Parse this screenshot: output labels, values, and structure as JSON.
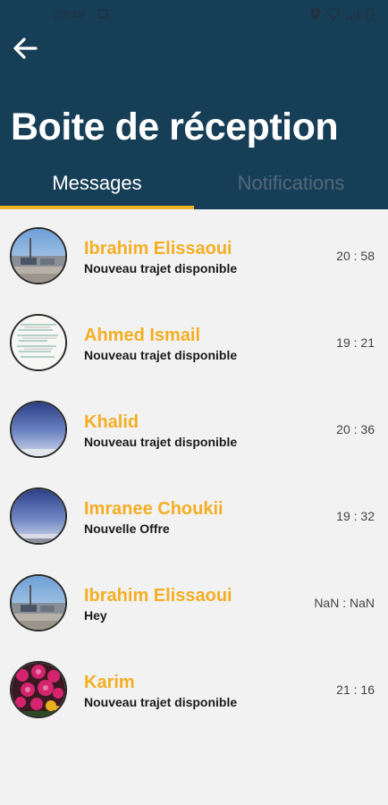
{
  "status": {
    "time": "20:48"
  },
  "header": {
    "title": "Boite de réception",
    "back_icon": "arrow-left-icon"
  },
  "tabs": [
    {
      "label": "Messages",
      "active": true
    },
    {
      "label": "Notifications",
      "active": false
    }
  ],
  "colors": {
    "header_bg": "#163e57",
    "accent": "#f4b325",
    "name": "#f4ae23",
    "background": "#f2f2f2"
  },
  "messages": [
    {
      "name": "Ibrahim Elissaoui",
      "text": "Nouveau trajet disponible",
      "time": "20 : 58",
      "avatar": "street-photo"
    },
    {
      "name": "Ahmed Ismail",
      "text": "Nouveau trajet disponible",
      "time": "19 : 21",
      "avatar": "document-photo"
    },
    {
      "name": "Khalid",
      "text": "Nouveau trajet disponible",
      "time": "20 : 36",
      "avatar": "sky-photo"
    },
    {
      "name": "Imranee Choukii",
      "text": "Nouvelle Offre",
      "time": "19 : 32",
      "avatar": "sky-photo"
    },
    {
      "name": "Ibrahim Elissaoui",
      "text": "Hey",
      "time": "NaN : NaN",
      "avatar": "street-photo"
    },
    {
      "name": "Karim",
      "text": "Nouveau trajet disponible",
      "time": "21 : 16",
      "avatar": "flowers-photo"
    }
  ]
}
